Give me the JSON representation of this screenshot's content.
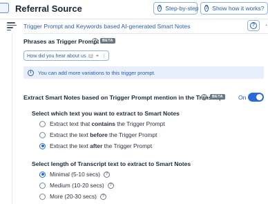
{
  "header": {
    "title": "Referral Source",
    "step_by_step": "Step-by-step",
    "how_it_works": "Show how it works?"
  },
  "section": {
    "title": "Trigger Prompt and Keywords based AI-generated Smart Notes"
  },
  "phrases": {
    "label": "Phrases as Trigger Prompt",
    "badge": "BETA",
    "chip_text": "How did you hear about us",
    "chip_count": "3",
    "info": "You can add more variations to this trigger prompt."
  },
  "extract": {
    "label": "Extract Smart Notes based on Trigger Prompt mention in the Transcript",
    "badge": "BETA",
    "toggle_label": "On",
    "toggle_on": true
  },
  "which_text": {
    "label": "Select which text you want to extract to Smart Notes",
    "options": [
      {
        "pre": "Extract text that ",
        "bold": "contains",
        "post": " the Trigger Prompt",
        "checked": false
      },
      {
        "pre": "Extract the text ",
        "bold": "before",
        "post": " the Trigger Prompt",
        "checked": false
      },
      {
        "pre": "Extract the text ",
        "bold": "after",
        "post": " the Trigger Prompt",
        "checked": true
      }
    ]
  },
  "length": {
    "label": "Select length of Transcript text to extract to Smart Notes",
    "options": [
      {
        "label": "Minimal (5-10 secs)",
        "checked": true
      },
      {
        "label": "Medium (10-20 secs)",
        "checked": false
      },
      {
        "label": "More (20-30 secs)",
        "checked": false
      }
    ]
  },
  "colors": {
    "accent": "#2a6ad8",
    "link": "#2a5db0",
    "info_bg": "#e6effb"
  }
}
